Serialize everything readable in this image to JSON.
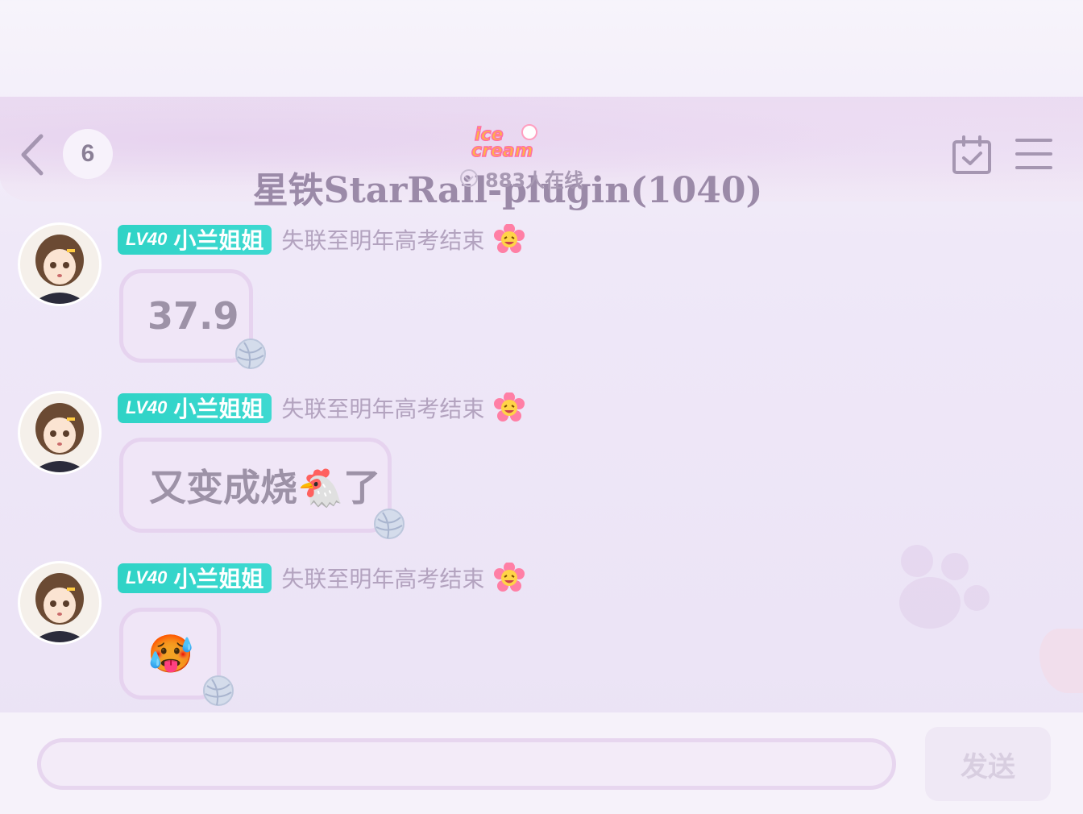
{
  "header": {
    "unread_count": "6",
    "group_title": "星铁StarRail-plugin(1040)",
    "online_status": "883人在线",
    "logo_text": "ice cream"
  },
  "messages": [
    {
      "level": "LV40",
      "username": "小兰姐姐",
      "signature": "失联至明年高考结束",
      "text": "37.9"
    },
    {
      "level": "LV40",
      "username": "小兰姐姐",
      "signature": "失联至明年高考结束",
      "text": "又变成烧🐔了"
    },
    {
      "level": "LV40",
      "username": "小兰姐姐",
      "signature": "失联至明年高考结束",
      "text": "🥵"
    }
  ],
  "composer": {
    "placeholder": "",
    "send_label": "发送"
  },
  "colors": {
    "level_badge": "#2fd3c6",
    "bubble_border": "#e6d3ef",
    "bubble_fill": "#f0e6f7",
    "title": "#9b8aa8"
  }
}
